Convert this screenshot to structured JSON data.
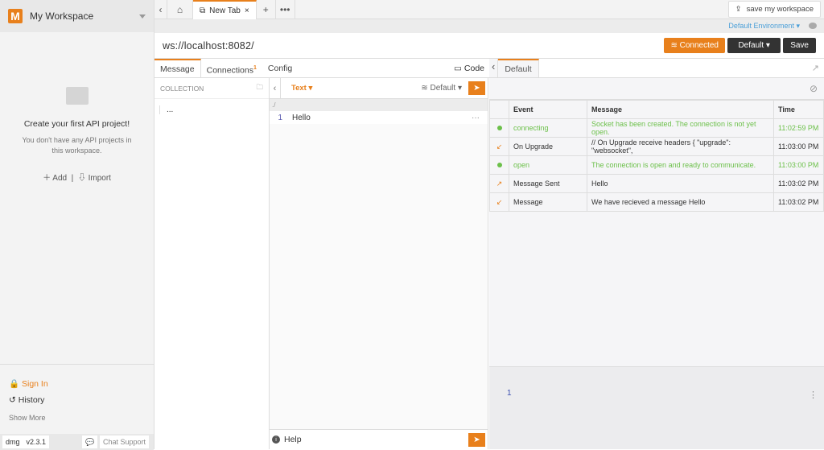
{
  "sidebar": {
    "logo": "M",
    "workspace": "My Workspace",
    "empty_title": "Create your first API project!",
    "empty_sub": "You don't have any API projects in this workspace.",
    "add": "Add",
    "import": "Import",
    "sign_in": "Sign In",
    "history": "History",
    "show_more": "Show More",
    "badge": "dmg",
    "version": "v2.3.1",
    "chat": "Chat Support"
  },
  "tabs": {
    "active": "New Tab",
    "save_ws": "save my workspace"
  },
  "env": {
    "label": "Default Environment"
  },
  "url": {
    "value": "ws://localhost:8082/",
    "status": "Connected",
    "default_btn": "Default",
    "save": "Save"
  },
  "left_tabs": [
    {
      "label": "Message"
    },
    {
      "label": "Connections",
      "sup": "1"
    },
    {
      "label": "Config"
    }
  ],
  "code_label": "Code",
  "collection": {
    "header": "COLLECTION",
    "item": "..."
  },
  "editor": {
    "type": "Text",
    "conn": "Default",
    "path": "./",
    "lines": [
      {
        "n": "1",
        "text": "Hello"
      }
    ],
    "more": "···",
    "help": "Help"
  },
  "right": {
    "tab": "Default",
    "columns": [
      "Event",
      "Message",
      "Time"
    ],
    "rows": [
      {
        "icon": "dot",
        "event": "connecting",
        "message": "Socket has been created. The connection is not yet open.",
        "time": "11:02:59 PM",
        "green": true
      },
      {
        "icon": "arrow-in",
        "event": "On Upgrade",
        "message": "// On Upgrade receive headers { \"upgrade\": \"websocket\",",
        "time": "11:03:00 PM",
        "green": false
      },
      {
        "icon": "dot",
        "event": "open",
        "message": "The connection is open and ready to communicate.",
        "time": "11:03:00 PM",
        "green": true
      },
      {
        "icon": "arrow-out",
        "event": "Message Sent",
        "message": "Hello",
        "time": "11:03:02 PM",
        "green": false
      },
      {
        "icon": "arrow-in",
        "event": "Message",
        "message": "We have recieved a message Hello",
        "time": "11:03:02 PM",
        "green": false
      }
    ],
    "bottom_line": "1",
    "bottom_menu": "⋮"
  },
  "colors": {
    "accent": "#e8801c",
    "green": "#6cc04a",
    "link": "#4a9fd8"
  }
}
